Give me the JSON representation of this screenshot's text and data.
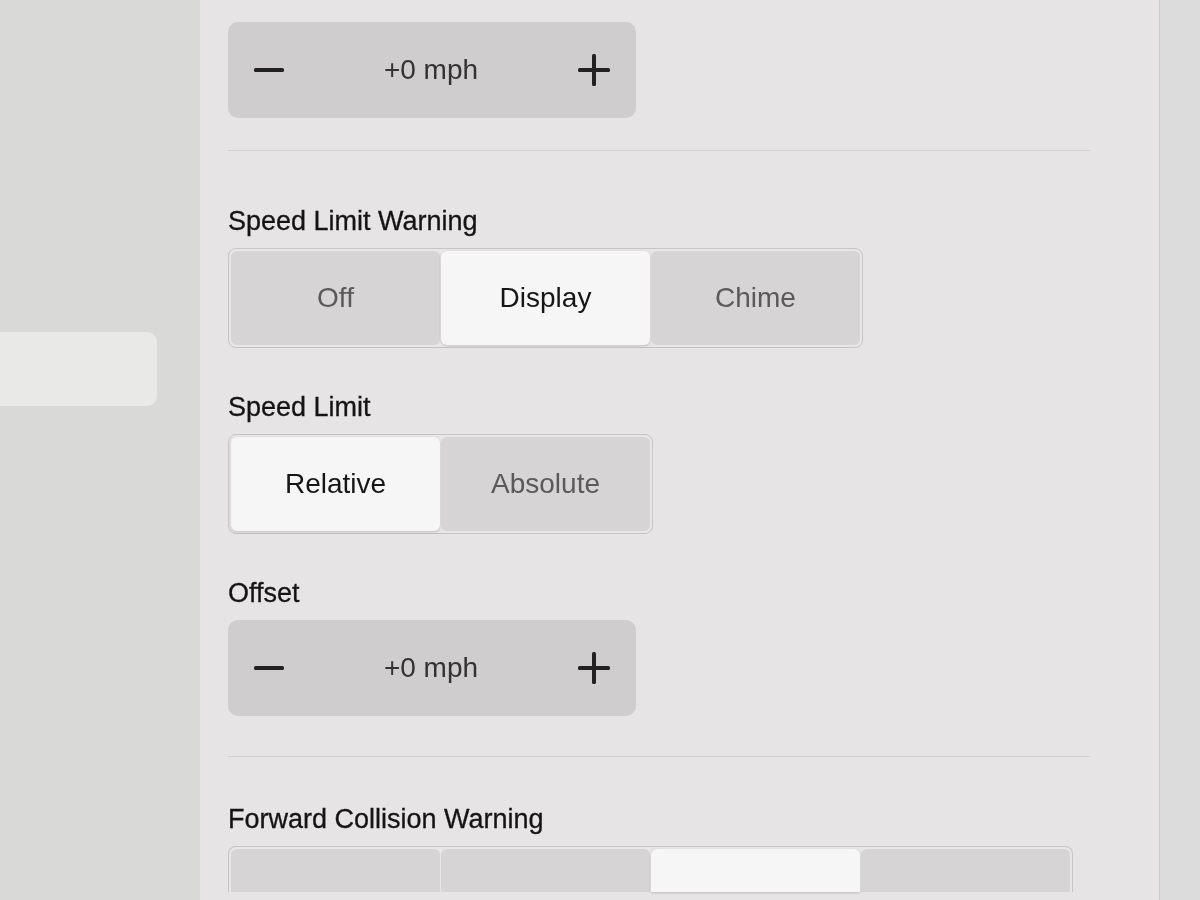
{
  "sidebar": {
    "items": [
      {
        "selected": true
      }
    ]
  },
  "sections": [
    {
      "settings": [
        {
          "kind": "stepper",
          "value": "+0 mph"
        }
      ]
    },
    {
      "settings": [
        {
          "kind": "segmented",
          "label": "Speed Limit Warning",
          "options": [
            {
              "label": "Off",
              "selected": false
            },
            {
              "label": "Display",
              "selected": true
            },
            {
              "label": "Chime",
              "selected": false
            }
          ]
        },
        {
          "kind": "segmented",
          "label": "Speed Limit",
          "options": [
            {
              "label": "Relative",
              "selected": true
            },
            {
              "label": "Absolute",
              "selected": false
            }
          ]
        },
        {
          "kind": "stepper",
          "label": "Offset",
          "value": "+0 mph"
        }
      ]
    },
    {
      "settings": [
        {
          "kind": "segmented",
          "label": "Forward Collision Warning",
          "options": [
            {
              "selected": false
            },
            {
              "selected": false
            },
            {
              "selected": true
            },
            {
              "selected": false
            }
          ]
        }
      ]
    }
  ]
}
